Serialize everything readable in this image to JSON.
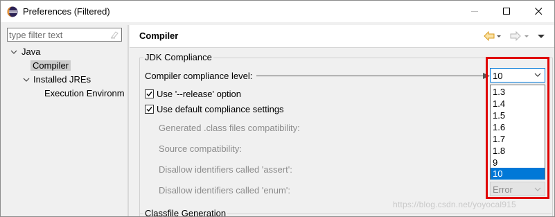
{
  "window": {
    "title": "Preferences (Filtered)"
  },
  "sidebar": {
    "filter_placeholder": "type filter text",
    "tree": [
      {
        "label": "Java",
        "expanded": true
      },
      {
        "label": "Compiler",
        "selected": true
      },
      {
        "label": "Installed JREs",
        "expanded": true
      },
      {
        "label": "Execution Environm"
      }
    ]
  },
  "page": {
    "title": "Compiler"
  },
  "jdk_compliance": {
    "group_title": "JDK Compliance",
    "compliance_level_label": "Compiler compliance level:",
    "compliance_level_value": "10",
    "release_option_label": "Use '--release' option",
    "release_option_checked": true,
    "default_settings_label": "Use default compliance settings",
    "default_settings_checked": true,
    "generated_class_label": "Generated .class files compatibility:",
    "source_compat_label": "Source compatibility:",
    "disallow_assert_label": "Disallow identifiers called 'assert':",
    "disallow_enum_label": "Disallow identifiers called 'enum':",
    "disallow_enum_value": "Error",
    "dropdown_options": [
      "1.3",
      "1.4",
      "1.5",
      "1.6",
      "1.7",
      "1.8",
      "9",
      "10"
    ],
    "dropdown_selected": "10"
  },
  "classfile": {
    "group_title": "Classfile Generation"
  },
  "watermark": "https://blog.csdn.net/yoyocal915",
  "colors": {
    "selection": "#0078d7",
    "highlight": "#e00000",
    "tree_selection": "#cccccc"
  }
}
